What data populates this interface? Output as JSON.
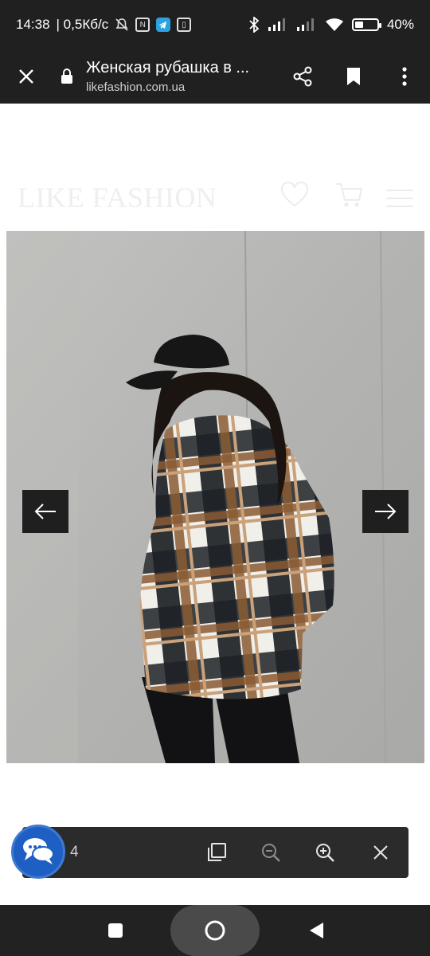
{
  "status_bar": {
    "time": "14:38",
    "speed": "| 0,5Кб/с",
    "battery_percent": "40%",
    "battery_level": 0.4
  },
  "browser": {
    "page_title": "Женская рубашка в ...",
    "url": "likefashion.com.ua",
    "icons": [
      "close-icon",
      "lock-icon",
      "share-icon",
      "bookmark-icon",
      "more-vert-icon"
    ]
  },
  "site": {
    "logo": "LIKE FASHION",
    "icons": [
      "heart-icon",
      "cart-icon",
      "menu-icon"
    ]
  },
  "gallery": {
    "photo_desc_icon": "product-photo",
    "prev_icon": "arrow-left-icon",
    "next_icon": "arrow-right-icon"
  },
  "zoom_bar": {
    "count": "4",
    "icons": [
      "copy-icon",
      "zoom-out-icon",
      "zoom-in-icon",
      "close-icon"
    ]
  },
  "colors": {
    "system_bar": "#202020",
    "chat_accent": "#1e5fc4",
    "zoom_bar": "#2b2b2b"
  }
}
